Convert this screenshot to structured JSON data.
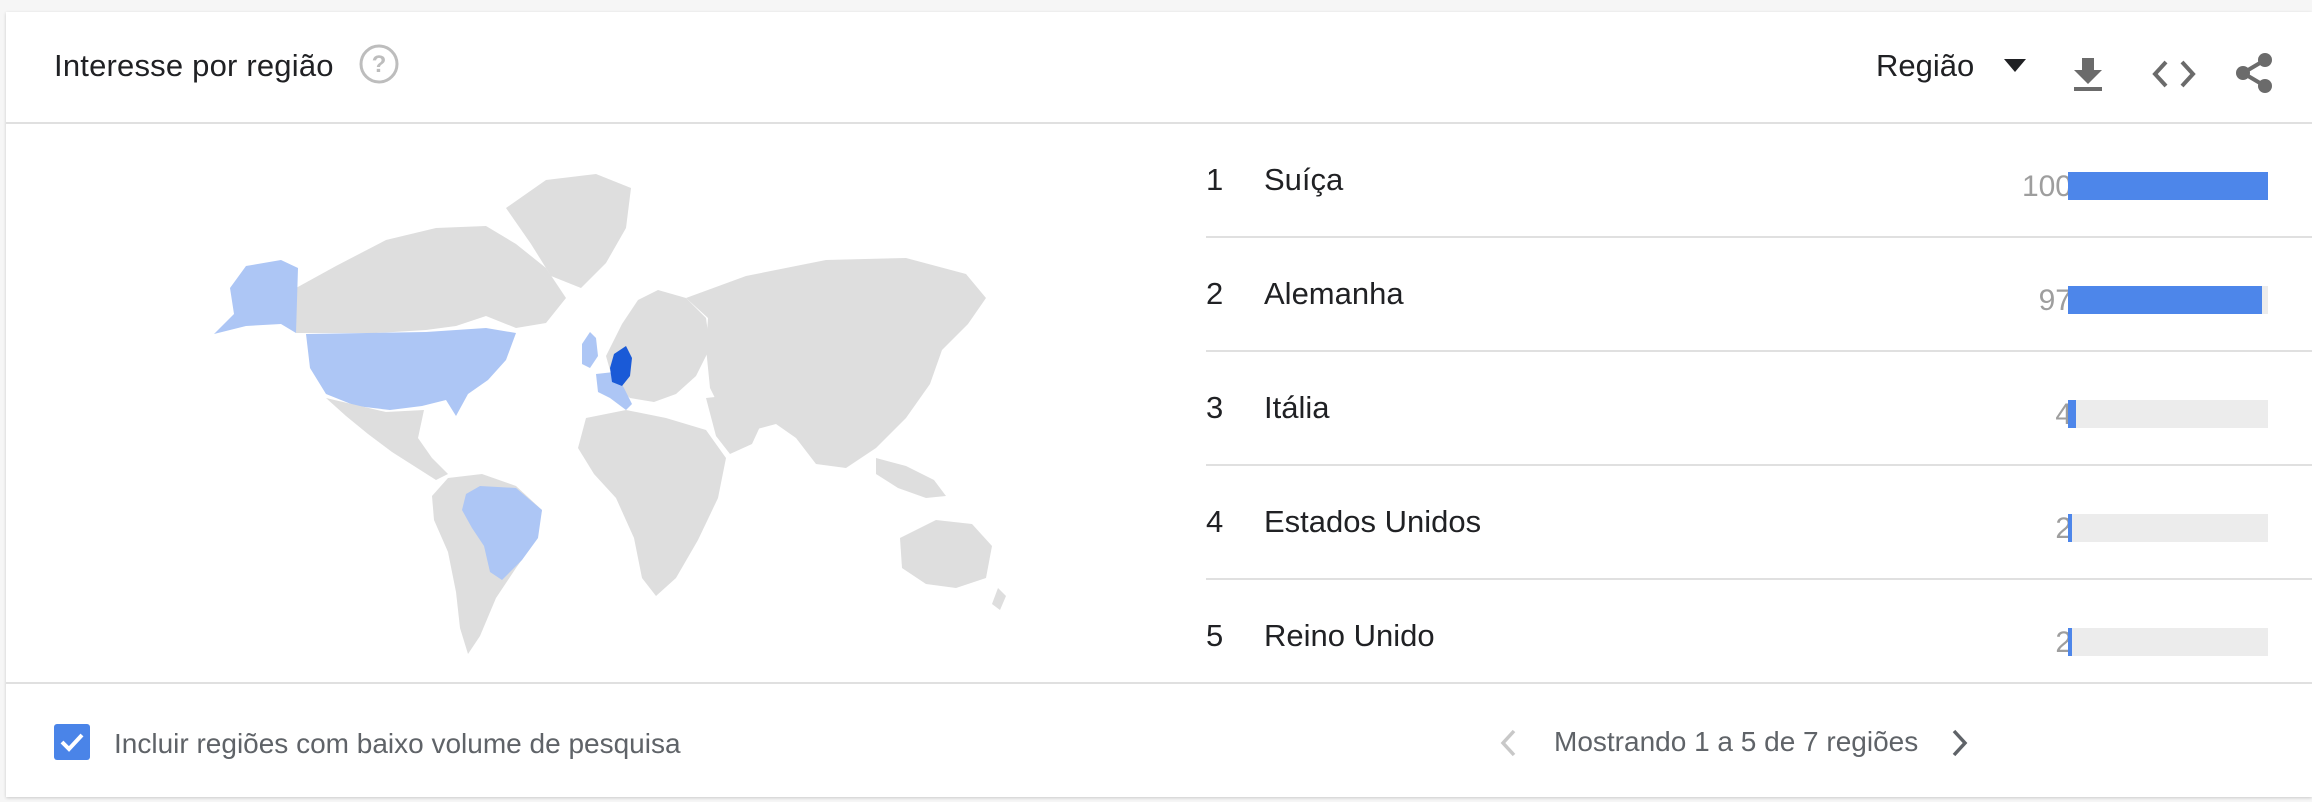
{
  "header": {
    "title": "Interesse por região",
    "help_icon": "help-circle-icon",
    "resolution_select": {
      "selected": "Região"
    },
    "tools": [
      "download-icon",
      "embed-code-icon",
      "share-icon"
    ]
  },
  "colors": {
    "bar_fill": "#4d86ea",
    "bar_track": "#ececec",
    "map_land": "#dedede",
    "map_low_interest": "#adc6f5",
    "map_high_interest": "#1a5ad7",
    "checkbox": "#4a84e8"
  },
  "regions": [
    {
      "rank": "1",
      "name": "Suíça",
      "value": 100
    },
    {
      "rank": "2",
      "name": "Alemanha",
      "value": 97
    },
    {
      "rank": "3",
      "name": "Itália",
      "value": 4
    },
    {
      "rank": "4",
      "name": "Estados Unidos",
      "value": 2
    },
    {
      "rank": "5",
      "name": "Reino Unido",
      "value": 2
    }
  ],
  "footer": {
    "include_low_volume": {
      "checked": true,
      "label": "Incluir regiões com baixo volume de pesquisa"
    },
    "pagination": {
      "text": "Mostrando 1 a 5 de 7 regiões"
    }
  }
}
